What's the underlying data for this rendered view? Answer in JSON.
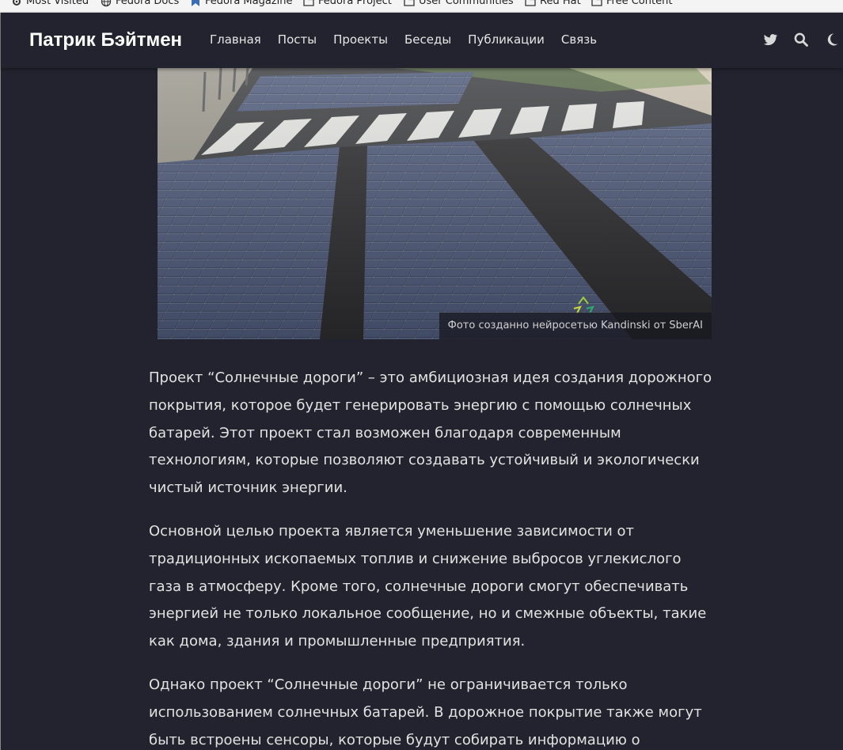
{
  "bookmarks": [
    {
      "label": "Most Visited",
      "icon": "gear-icon"
    },
    {
      "label": "Fedora Docs",
      "icon": "globe-icon"
    },
    {
      "label": "Fedora Magazine",
      "icon": "fedora-bookmark-icon"
    },
    {
      "label": "Fedora Project",
      "icon": "folder-icon"
    },
    {
      "label": "User Communities",
      "icon": "folder-icon"
    },
    {
      "label": "Red Hat",
      "icon": "folder-icon"
    },
    {
      "label": "Free Content",
      "icon": "folder-icon"
    }
  ],
  "header": {
    "title": "Патрик Бэйтмен",
    "nav": [
      "Главная",
      "Посты",
      "Проекты",
      "Беседы",
      "Публикации",
      "Связь"
    ],
    "icons": [
      "twitter-icon",
      "search-icon",
      "moon-icon"
    ]
  },
  "hero": {
    "caption": "Фото созданно нейросетью Kandinski от SberAI"
  },
  "article": {
    "paragraphs": [
      "Проект “Солнечные дороги” – это амбициозная идея создания дорожного покрытия, которое будет генерировать энергию с помощью солнечных батарей. Этот проект стал возможен благодаря современным технологиям, которые позволяют создавать устойчивый и экологически чистый источник энергии.",
      "Основной целью проекта является уменьшение зависимости от традиционных ископаемых топлив и снижение выбросов углекислого газа в атмосферу. Кроме того, солнечные дороги смогут обеспечивать энергией не только локальное сообщение, но и смежные объекты, такие как дома, здания и промышленные предприятия.",
      "Однако проект “Солнечные дороги” не ограничивается только использованием солнечных батарей. В дорожное покрытие также могут быть встроены сенсоры, которые будут собирать информацию о"
    ]
  },
  "colors": {
    "background": "#22232e",
    "text": "#e2e2e2",
    "title": "#ffffff"
  }
}
